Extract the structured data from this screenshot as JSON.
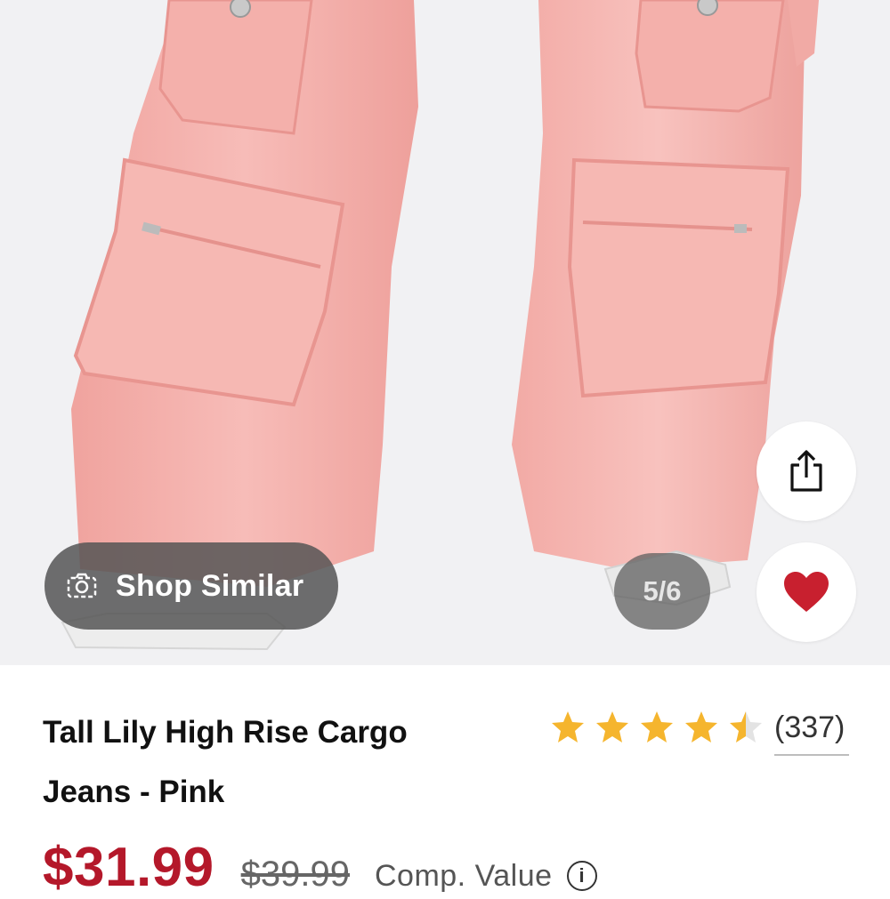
{
  "gallery": {
    "shop_similar_label": "Shop Similar",
    "image_counter": "5/6"
  },
  "product": {
    "title_line1": "Tall Lily High Rise Cargo",
    "title_line2": "Jeans - Pink",
    "rating": 4.5,
    "rating_max": 5,
    "review_count": "(337)",
    "price": "$31.99",
    "compare_price": "$39.99",
    "compare_label": "Comp. Value",
    "info_glyph": "i"
  },
  "colors": {
    "price_red": "#b4182a",
    "star_gold": "#f5b52e",
    "heart_red": "#c8202f",
    "denim_pink": "#f7b0ad"
  },
  "icons": [
    "camera-icon",
    "share-icon",
    "heart-icon",
    "star-icon",
    "info-icon"
  ]
}
